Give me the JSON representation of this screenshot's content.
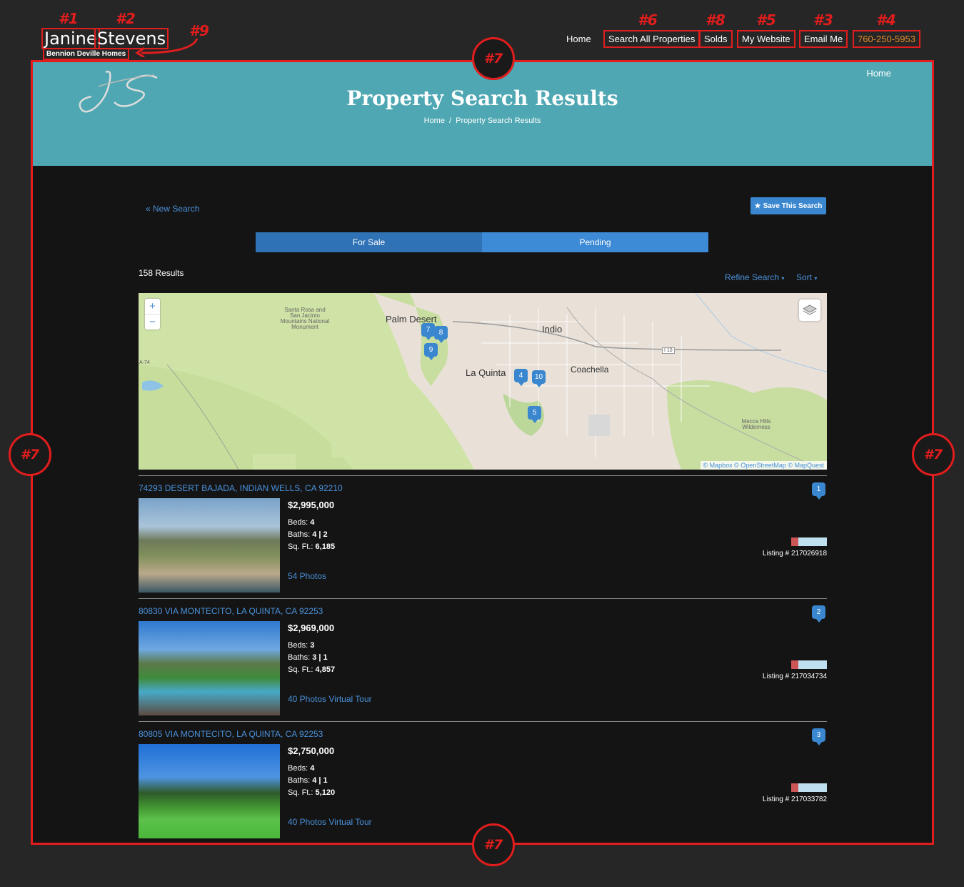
{
  "annotations": {
    "n1": "#1",
    "n2": "#2",
    "n3": "#3",
    "n4": "#4",
    "n5": "#5",
    "n6": "#6",
    "n7": "#7",
    "n8": "#8",
    "n9": "#9"
  },
  "brand": {
    "first_name": "Janine",
    "last_name": "Stevens",
    "company": "Bennion Deville Homes"
  },
  "topnav": {
    "home": "Home",
    "search_all": "Search All Properties",
    "solds": "Solds",
    "my_website": "My Website",
    "email_me": "Email Me",
    "phone": "760-250-5953"
  },
  "hero": {
    "logo_text": "JS",
    "home_link": "Home",
    "title": "Property Search Results",
    "breadcrumb": {
      "home": "Home",
      "sep": "/",
      "current": "Property Search Results"
    }
  },
  "controls": {
    "new_search": "« New Search",
    "save_search": "Save This Search",
    "tabs": [
      "For Sale",
      "Pending"
    ],
    "results_count": "158 Results",
    "refine": "Refine Search",
    "sort": "Sort"
  },
  "map": {
    "zoom_in": "+",
    "zoom_out": "−",
    "labels": {
      "palm_desert": "Palm Desert",
      "indio": "Indio",
      "la_quinta": "La Quinta",
      "coachella": "Coachella",
      "santa_rosa": "Santa Rosa and San Jacinto Mountains National Monument",
      "mecca": "Mecca Hills Wilderness",
      "i10": "I 10",
      "a74": "A-74"
    },
    "markers": [
      "7",
      "8",
      "9",
      "4",
      "10",
      "5"
    ],
    "attribution": "© Mapbox © OpenStreetMap © MapQuest"
  },
  "listings": [
    {
      "marker": "1",
      "address": "74293 DESERT BAJADA, INDIAN WELLS, CA 92210",
      "price": "$2,995,000",
      "beds_label": "Beds:",
      "beds": "4",
      "baths_label": "Baths:",
      "baths": "4 | 2",
      "sqft_label": "Sq. Ft.:",
      "sqft": "6,185",
      "photos": "54 Photos",
      "listing_no": "Listing # 217026918"
    },
    {
      "marker": "2",
      "address": "80830 VIA MONTECITO, LA QUINTA, CA 92253",
      "price": "$2,969,000",
      "beds_label": "Beds:",
      "beds": "3",
      "baths_label": "Baths:",
      "baths": "3 | 1",
      "sqft_label": "Sq. Ft.:",
      "sqft": "4,857",
      "photos": "40 Photos Virtual Tour",
      "listing_no": "Listing # 217034734"
    },
    {
      "marker": "3",
      "address": "80805 VIA MONTECITO, LA QUINTA, CA 92253",
      "price": "$2,750,000",
      "beds_label": "Beds:",
      "beds": "4",
      "baths_label": "Baths:",
      "baths": "4 | 1",
      "sqft_label": "Sq. Ft.:",
      "sqft": "5,120",
      "photos": "40 Photos Virtual Tour",
      "listing_no": "Listing # 217033782"
    }
  ],
  "colors": {
    "annotation_red": "#e11d1d",
    "hero_teal": "#4ea7b2",
    "link_blue": "#4a90d9",
    "button_blue": "#3a87d0",
    "phone_orange": "#e88a2a"
  }
}
